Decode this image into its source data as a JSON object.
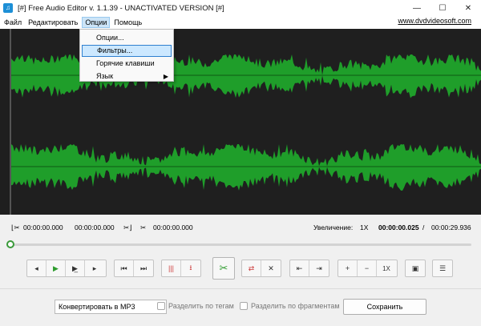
{
  "window": {
    "title": "[#] Free Audio Editor v. 1.1.39 - UNACTIVATED VERSION [#]",
    "app_icon": "audio-editor-icon",
    "controls": {
      "minimize": "—",
      "maximize": "☐",
      "close": "✕"
    }
  },
  "menu": {
    "items": [
      "Файл",
      "Редактировать",
      "Опции",
      "Помощь"
    ],
    "active_index": 2,
    "site_link": "www.dvdvideosoft.com"
  },
  "dropdown": {
    "items": [
      {
        "label": "Опции..."
      },
      {
        "label": "Фильтры...",
        "highlighted": true
      },
      {
        "label": "Горячие клавиши"
      },
      {
        "label": "Язык",
        "submenu": true
      }
    ]
  },
  "waveform": {
    "color": "#1f9e2a",
    "background": "#1f1f1f",
    "channels": 2
  },
  "time_row": {
    "sel_start": "00:00:00.000",
    "sel_end": "00:00:00.000",
    "cut_time": "00:00:00.000",
    "zoom_label": "Увеличение:",
    "zoom_value": "1X",
    "position": "00:00:00.025",
    "separator": "/",
    "duration": "00:00:29.936"
  },
  "slider": {
    "progress": 0.0
  },
  "toolbar": {
    "zoom_label": "1X"
  },
  "bottom": {
    "format_select": "Конвертировать в MP3",
    "split_by_tags": "Разделить по тегам",
    "split_by_fragments": "Разделить по фрагментам",
    "save_label": "Сохранить"
  }
}
